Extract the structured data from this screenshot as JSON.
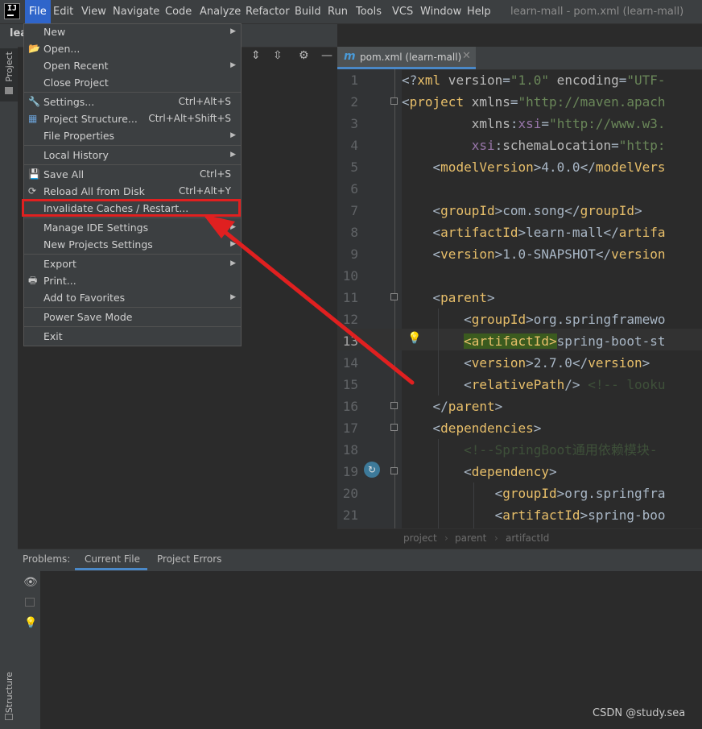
{
  "window": {
    "title": "learn-mall - pom.xml (learn-mall)"
  },
  "menubar": {
    "items": [
      "File",
      "Edit",
      "View",
      "Navigate",
      "Code",
      "Analyze",
      "Refactor",
      "Build",
      "Run",
      "Tools",
      "VCS",
      "Window",
      "Help"
    ],
    "active": "File"
  },
  "project_panel": {
    "title": "lea",
    "side_tab": "Project"
  },
  "left_strip": {
    "structure_label": "Structure"
  },
  "editor": {
    "tab_label": "pom.xml (learn-mall)",
    "line_numbers": [
      "1",
      "2",
      "3",
      "4",
      "5",
      "6",
      "7",
      "8",
      "9",
      "10",
      "11",
      "12",
      "13",
      "14",
      "15",
      "16",
      "17",
      "18",
      "19",
      "20",
      "21"
    ],
    "current_line": "13"
  },
  "breadcrumb": [
    "project",
    "parent",
    "artifactId"
  ],
  "problems": {
    "label": "Problems:",
    "tabs": [
      "Current File",
      "Project Errors"
    ],
    "active_tab": "Current File"
  },
  "file_menu": {
    "items": [
      {
        "label": "New",
        "submenu": true
      },
      {
        "label": "Open...",
        "icon": "folder-icon"
      },
      {
        "label": "Open Recent",
        "submenu": true
      },
      {
        "label": "Close Project"
      },
      {
        "label": "Settings...",
        "shortcut": "Ctrl+Alt+S",
        "icon": "wrench-icon"
      },
      {
        "label": "Project Structure...",
        "shortcut": "Ctrl+Alt+Shift+S",
        "icon": "project-structure-icon"
      },
      {
        "label": "File Properties",
        "submenu": true
      },
      {
        "label": "Local History",
        "submenu": true
      },
      {
        "label": "Save All",
        "shortcut": "Ctrl+S",
        "icon": "save-icon"
      },
      {
        "label": "Reload All from Disk",
        "shortcut": "Ctrl+Alt+Y",
        "icon": "reload-icon"
      },
      {
        "label": "Invalidate Caches / Restart..."
      },
      {
        "label": "Manage IDE Settings",
        "submenu": true
      },
      {
        "label": "New Projects Settings",
        "submenu": true
      },
      {
        "label": "Export",
        "submenu": true
      },
      {
        "label": "Print...",
        "icon": "print-icon"
      },
      {
        "label": "Add to Favorites",
        "submenu": true
      },
      {
        "label": "Power Save Mode"
      },
      {
        "label": "Exit"
      }
    ],
    "highlighted": "Invalidate Caches / Restart..."
  },
  "annotation": {
    "color": "#e02020"
  },
  "watermark": "CSDN @study.sea"
}
